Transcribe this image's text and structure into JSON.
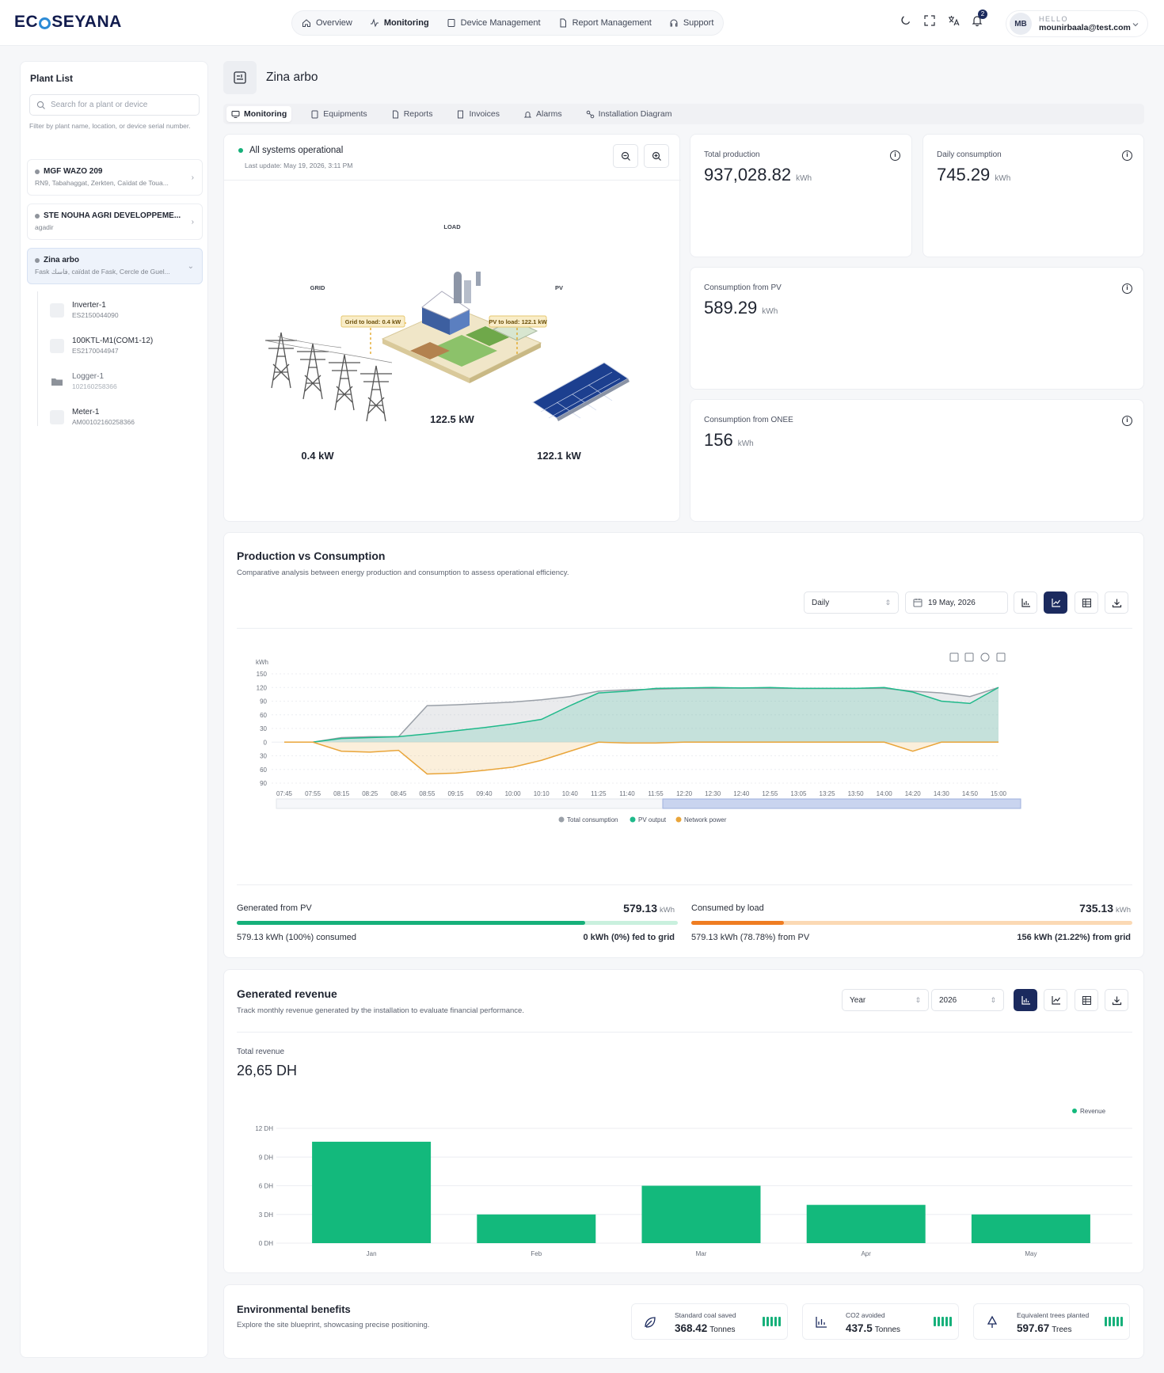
{
  "brand": {
    "logo_left": "EC",
    "logo_right": "SEYANA"
  },
  "nav": {
    "items": [
      {
        "label": "Overview",
        "icon": "home-icon"
      },
      {
        "label": "Monitoring",
        "icon": "activity-icon"
      },
      {
        "label": "Device Management",
        "icon": "device-icon"
      },
      {
        "label": "Report Management",
        "icon": "file-icon"
      },
      {
        "label": "Support",
        "icon": "headset-icon"
      }
    ],
    "active": "Monitoring"
  },
  "topbar": {
    "notifications": "2",
    "avatar": "MB",
    "hello": "HELLO",
    "email": "mounirbaala@test.com"
  },
  "sidebar": {
    "title": "Plant List",
    "search_placeholder": "Search for a plant or device",
    "help": "Filter by plant name, location, or device serial number.",
    "plants": [
      {
        "name": "MGF WAZO 209",
        "location": "RN9, Tabahaggat, Zerkten, Caïdat de Toua..."
      },
      {
        "name": "STE NOUHA AGRI DEVELOPPEME...",
        "location": "agadir"
      },
      {
        "name": "Zina arbo",
        "location": "Fask فاسك, caïdat de Fask, Cercle de Guel..."
      }
    ],
    "devices": [
      {
        "name": "Inverter-1",
        "serial": "ES2150044090"
      },
      {
        "name": "100KTL-M1(COM1-12)",
        "serial": "ES2170044947"
      },
      {
        "name": "Logger-1",
        "serial": "102160258366"
      },
      {
        "name": "Meter-1",
        "serial": "AM00102160258366"
      }
    ]
  },
  "page": {
    "title": "Zina arbo"
  },
  "tabs": [
    "Monitoring",
    "Equipments",
    "Reports",
    "Invoices",
    "Alarms",
    "Installation Diagram"
  ],
  "diagram": {
    "status": "All systems operational",
    "last_update": "Last update: May 19, 2026, 3:11 PM",
    "load_label": "LOAD",
    "grid_label": "GRID",
    "pv_label": "PV",
    "grid_to_load": "Grid to load: 0.4 kW",
    "pv_to_load": "PV to load: 122.1 kW",
    "load_power": "122.5 kW",
    "grid_power": "0.4 kW",
    "pv_power": "122.1 kW"
  },
  "stats": [
    {
      "label": "Total production",
      "value": "937,028.82",
      "unit": "kWh"
    },
    {
      "label": "Daily consumption",
      "value": "745.29",
      "unit": "kWh"
    },
    {
      "label": "Consumption from PV",
      "value": "589.29",
      "unit": "kWh"
    },
    {
      "label": "Consumption from ONEE",
      "value": "156",
      "unit": "kWh"
    }
  ],
  "pvc": {
    "title": "Production vs Consumption",
    "subtitle": "Comparative analysis between energy production and consumption to assess operational efficiency.",
    "period": "Daily",
    "date": "19 May, 2026",
    "generated_label": "Generated from PV",
    "generated_value": "579.13",
    "unit": "kWh",
    "consumed_label": "Consumed by load",
    "consumed_value": "735.13",
    "gen_left": "579.13 kWh (100%) consumed",
    "gen_right": "0 kWh (0%) fed to grid",
    "con_left": "579.13 kWh (78.78%) from PV",
    "con_right": "156 kWh (21.22%) from grid",
    "gen_fraction": 0.79,
    "con_fraction": 0.21
  },
  "revenue": {
    "title": "Generated revenue",
    "subtitle": "Track monthly revenue generated by the installation to evaluate financial performance.",
    "period": "Year",
    "year": "2026",
    "total_label": "Total revenue",
    "total_value": "26,65 DH"
  },
  "env": {
    "title": "Environmental benefits",
    "subtitle": "Explore the site blueprint, showcasing precise positioning.",
    "items": [
      {
        "label": "Standard coal saved",
        "value": "368.42",
        "unit": "Tonnes",
        "icon": "leaf-icon"
      },
      {
        "label": "CO2 avoided",
        "value": "437.5",
        "unit": "Tonnes",
        "icon": "chart-icon"
      },
      {
        "label": "Equivalent trees planted",
        "value": "597.67",
        "unit": "Trees",
        "icon": "tree-icon"
      }
    ]
  },
  "chart_data": [
    {
      "type": "area",
      "ylabel": "kWh",
      "y_ticks": [
        "150",
        "120",
        "90",
        "60",
        "30",
        "0",
        "30",
        "60",
        "90"
      ],
      "ylim": [
        -90,
        150
      ],
      "x": [
        "07:45",
        "07:55",
        "08:15",
        "08:25",
        "08:45",
        "08:55",
        "09:15",
        "09:40",
        "10:00",
        "10:10",
        "10:40",
        "11:25",
        "11:40",
        "11:55",
        "12:20",
        "12:30",
        "12:40",
        "12:55",
        "13:05",
        "13:25",
        "13:50",
        "14:00",
        "14:20",
        "14:30",
        "14:50",
        "15:00"
      ],
      "series": [
        {
          "name": "Total consumption",
          "color": "#9aa0a8",
          "values": [
            0,
            0,
            10,
            12,
            12,
            80,
            82,
            85,
            88,
            93,
            100,
            112,
            115,
            116,
            118,
            118,
            119,
            118,
            118,
            118,
            118,
            118,
            112,
            108,
            100,
            120
          ]
        },
        {
          "name": "PV output",
          "color": "#1fb98a",
          "values": [
            0,
            0,
            8,
            10,
            12,
            18,
            25,
            32,
            40,
            50,
            80,
            108,
            112,
            118,
            119,
            120,
            119,
            120,
            118,
            118,
            118,
            120,
            110,
            90,
            85,
            120
          ]
        },
        {
          "name": "Network power",
          "color": "#e9a53a",
          "values": [
            0,
            0,
            -20,
            -22,
            -18,
            -70,
            -68,
            -62,
            -55,
            -40,
            -20,
            0,
            -2,
            -2,
            0,
            0,
            0,
            0,
            0,
            0,
            0,
            0,
            -20,
            0,
            0,
            0
          ]
        }
      ],
      "legend": "bottom"
    },
    {
      "type": "bar",
      "title": "",
      "categories": [
        "Jan",
        "Feb",
        "Mar",
        "Apr",
        "May"
      ],
      "series": [
        {
          "name": "Revenue",
          "color": "#13b97c",
          "values": [
            10.6,
            3.0,
            6.0,
            4.0,
            3.0
          ]
        }
      ],
      "y_ticks": [
        "12 DH",
        "9 DH",
        "6 DH",
        "3 DH",
        "0 DH"
      ],
      "ylim": [
        0,
        12
      ],
      "legend": "top-right"
    }
  ]
}
